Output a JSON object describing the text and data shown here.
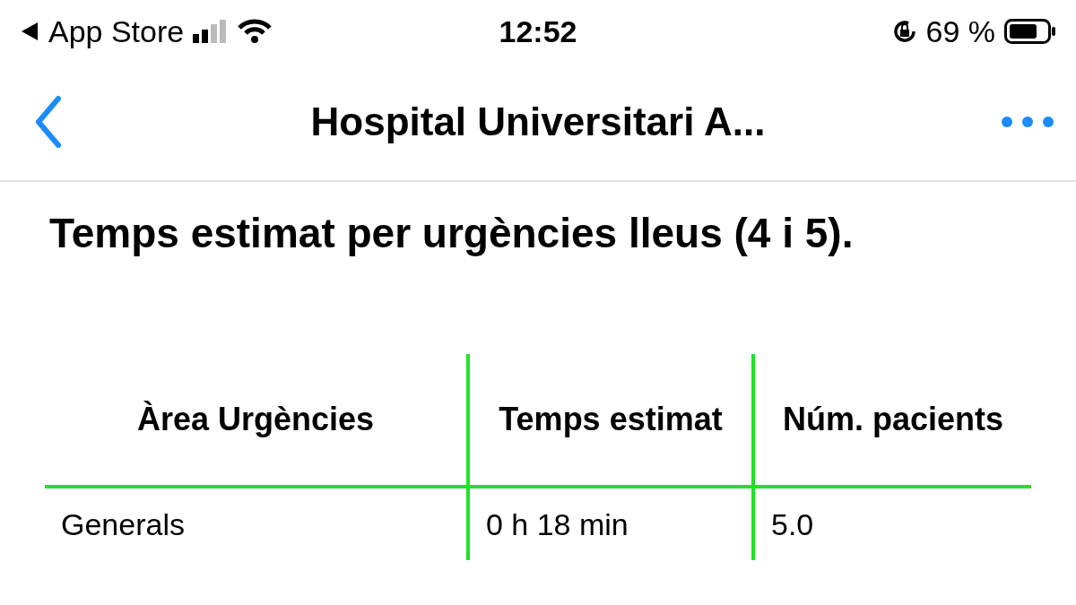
{
  "status_bar": {
    "app": "App Store",
    "time": "12:52",
    "battery_percent": "69 %"
  },
  "nav_bar": {
    "title": "Hospital Universitari A..."
  },
  "heading": "Temps estimat per urgències lleus (4 i 5).",
  "table": {
    "columns": [
      "Àrea Urgències",
      "Temps estimat",
      "Núm. pacients"
    ],
    "rows": [
      [
        "Generals",
        "0 h 18 min",
        "5.0"
      ]
    ]
  }
}
